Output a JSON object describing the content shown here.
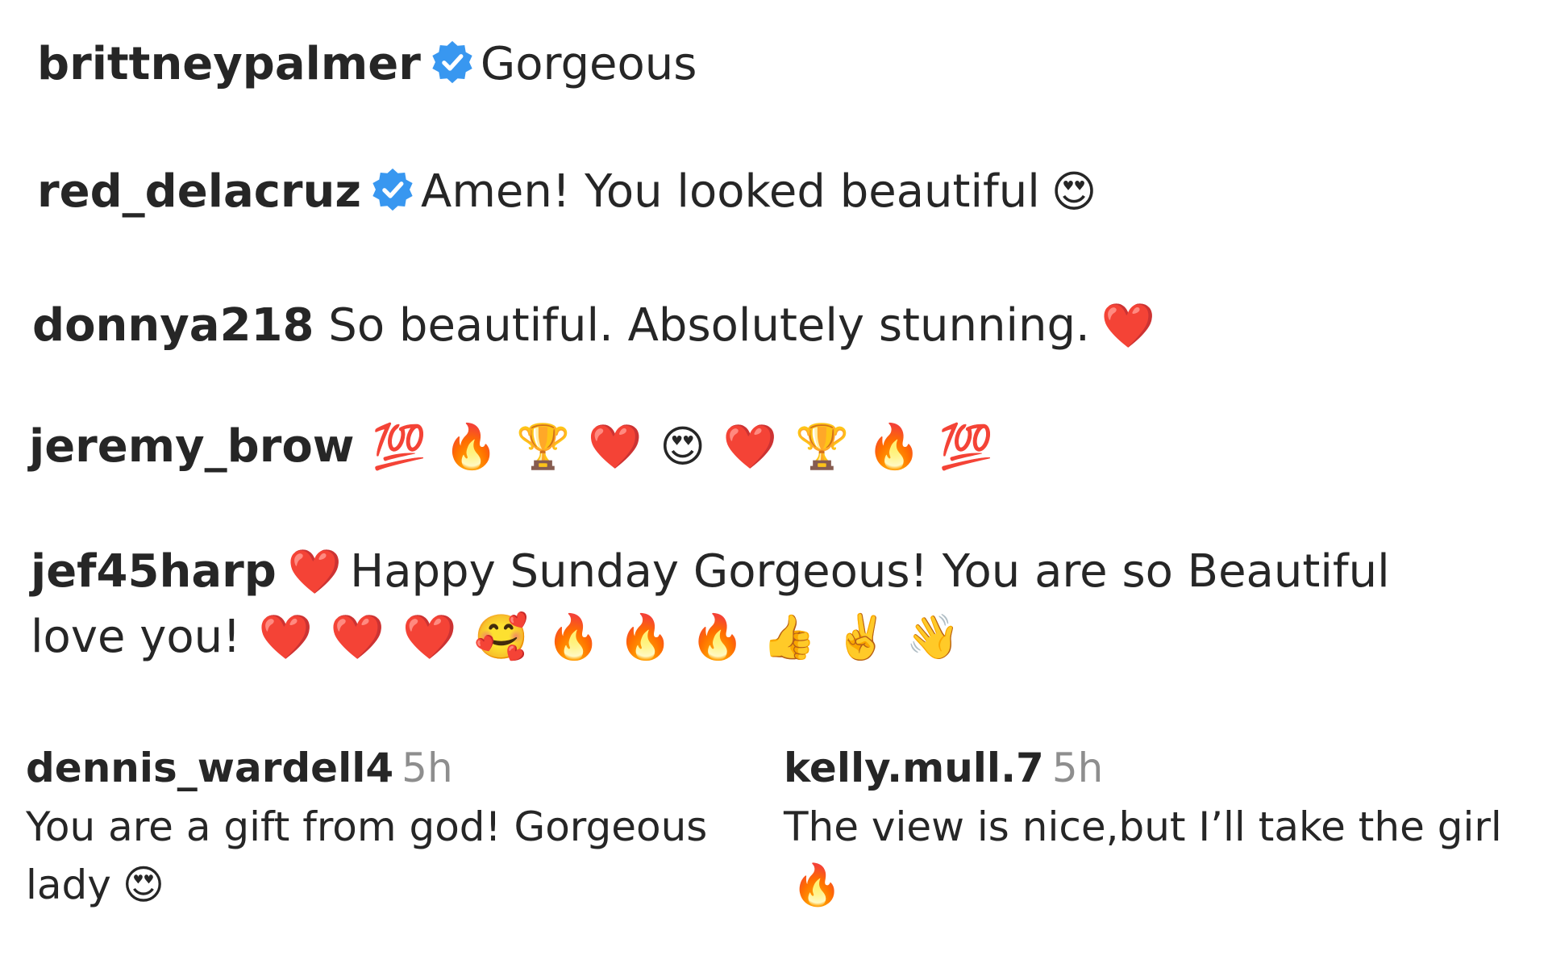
{
  "comments": [
    {
      "username": "brittneypalmer",
      "verified": true,
      "text": "Gorgeous",
      "emojis": []
    },
    {
      "username": "red_delacruz",
      "verified": true,
      "text": "Amen! You looked beautiful",
      "emojis": [
        "😍"
      ]
    },
    {
      "username": "donnya218",
      "verified": false,
      "text": "So beautiful. Absolutely stunning.",
      "emojis": [
        "❤️"
      ]
    },
    {
      "username": "jeremy_brow",
      "verified": false,
      "text": "",
      "emojis": [
        "💯",
        "🔥",
        "🏆",
        "❤️",
        "😍",
        "❤️",
        "🏆",
        "🔥",
        "💯"
      ]
    },
    {
      "username": "jef45harp",
      "verified": false,
      "lead_emoji": "❤️",
      "text_line1": "Happy Sunday Gorgeous! You are so Beautiful",
      "text_line2": "love you!",
      "emojis": [
        "❤️",
        "❤️",
        "❤️",
        "🥰",
        "🔥",
        "🔥",
        "🔥",
        "👍",
        "✌️",
        "👋"
      ]
    }
  ],
  "bottom_comments": [
    {
      "username": "dennis_wardell4",
      "time": "5h",
      "text_line1": "You are a gift from god! Gorgeous",
      "text_line2": "lady",
      "emojis": [
        "😍"
      ]
    },
    {
      "username": "kelly.mull.7",
      "time": "5h",
      "text_line1": "The view is nice,but I’ll take the girl",
      "text_line2": "",
      "emojis": [
        "🔥"
      ]
    }
  ],
  "colors": {
    "verified_badge": "#3897f0",
    "text": "#262626",
    "time": "#8e8e8e"
  },
  "icons": {
    "verified": "verified-badge-icon"
  }
}
